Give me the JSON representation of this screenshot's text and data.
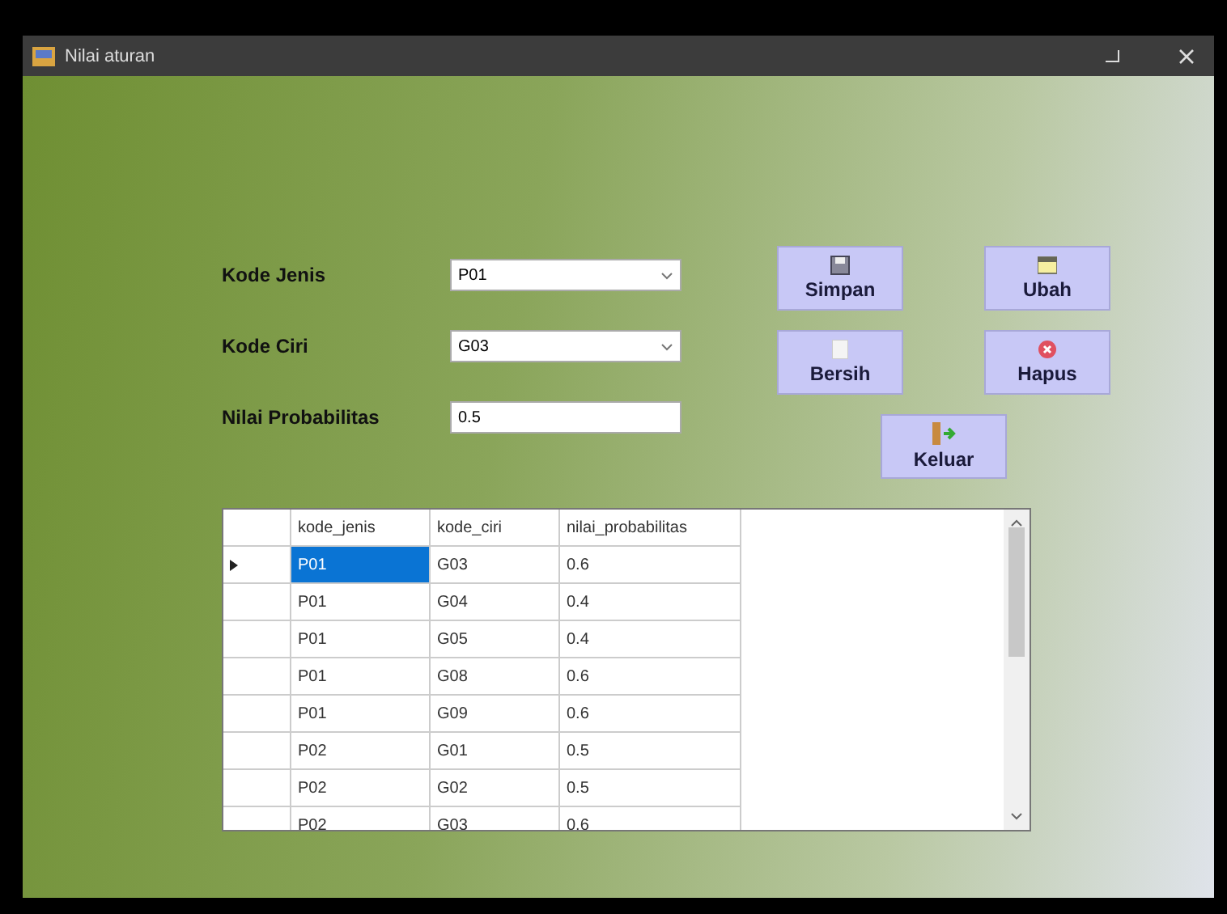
{
  "window": {
    "title": "Nilai aturan"
  },
  "fields": [
    {
      "kind": "combo",
      "label": "Kode Jenis",
      "value": "P01"
    },
    {
      "kind": "combo",
      "label": "Kode Ciri",
      "value": "G03"
    },
    {
      "kind": "text",
      "label": "Nilai Probabilitas",
      "value": "0.5"
    }
  ],
  "buttons": [
    {
      "kind": "save",
      "label": "Simpan"
    },
    {
      "kind": "edit",
      "label": "Ubah"
    },
    {
      "kind": "clear",
      "label": "Bersih"
    },
    {
      "kind": "delete",
      "label": "Hapus"
    },
    {
      "kind": "exit",
      "label": "Keluar"
    }
  ],
  "table": {
    "columns": [
      "kode_jenis",
      "kode_ciri",
      "nilai_probabilitas"
    ],
    "rows": [
      {
        "cells": [
          "P01",
          "G03",
          "0.6"
        ],
        "selected": true
      },
      {
        "cells": [
          "P01",
          "G04",
          "0.4"
        ],
        "selected": false
      },
      {
        "cells": [
          "P01",
          "G05",
          "0.4"
        ],
        "selected": false
      },
      {
        "cells": [
          "P01",
          "G08",
          "0.6"
        ],
        "selected": false
      },
      {
        "cells": [
          "P01",
          "G09",
          "0.6"
        ],
        "selected": false
      },
      {
        "cells": [
          "P02",
          "G01",
          "0.5"
        ],
        "selected": false
      },
      {
        "cells": [
          "P02",
          "G02",
          "0.5"
        ],
        "selected": false
      },
      {
        "cells": [
          "P02",
          "G03",
          "0.6"
        ],
        "selected": false
      }
    ]
  }
}
